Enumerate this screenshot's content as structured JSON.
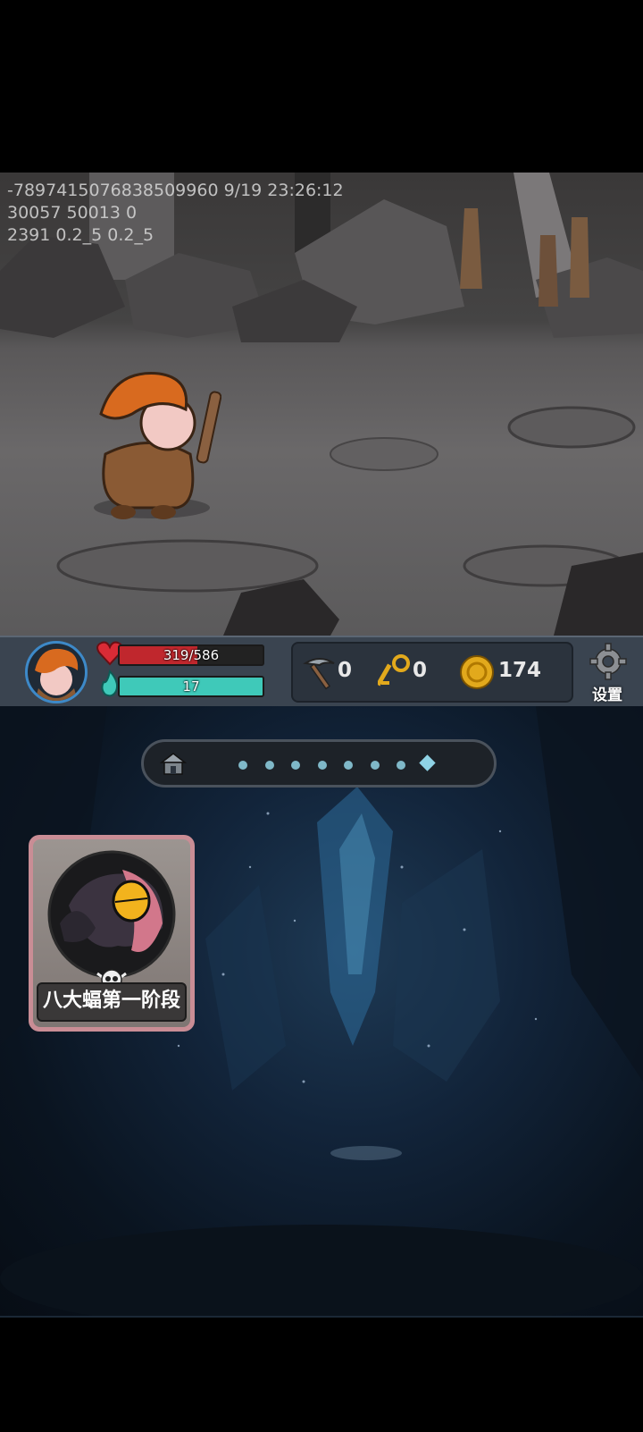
{
  "debug": {
    "line1": "-7897415076838509960 9/19 23:26:12",
    "line2": "30057 50013 0",
    "line3": "2391 0.2_5 0.2_5"
  },
  "hud": {
    "hp_text": "319/586",
    "hp_value": 319,
    "hp_max": 586,
    "mana_text": "17",
    "pickaxe_count": "0",
    "key_count": "0",
    "gold_count": "174",
    "settings_label": "设置"
  },
  "stage": {
    "progress_dots": 7,
    "current_marker": "diamond",
    "boss_label": "八大蝠第一阶段"
  },
  "colors": {
    "hp": "#c0272d",
    "mana": "#3fc9b9",
    "gold": "#e2a91c",
    "avatar_ring": "#3d89c8",
    "card_border": "#c98d95"
  },
  "icons": [
    "heart-icon",
    "mana-flame-icon",
    "pickaxe-icon",
    "key-icon",
    "gold-coin-icon",
    "gear-icon",
    "house-icon",
    "skull-icon"
  ]
}
